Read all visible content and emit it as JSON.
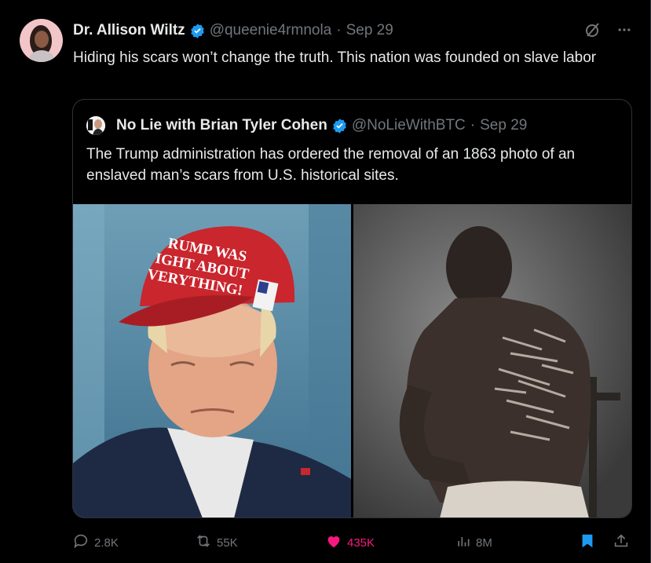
{
  "post": {
    "author_name": "Dr. Allison Wiltz",
    "handle": "@queenie4rmnola",
    "separator": "·",
    "date": "Sep 29",
    "text": "Hiding his scars won’t change the truth. This nation was founded on slave labor",
    "more_icon": "more-horizontal-icon",
    "grok_icon": "grok-slash-icon"
  },
  "quote": {
    "author_name": "No Lie with Brian Tyler Cohen",
    "handle": "@NoLieWithBTC",
    "separator": "·",
    "date": "Sep 29",
    "text": "The Trump administration has ordered the removal of an 1863 photo of an enslaved man’s scars from U.S. historical sites.",
    "hat_text_line1": "RUMP WAS",
    "hat_text_line2": "IGHT ABOUT",
    "hat_text_line3": "VERYTHING!"
  },
  "actions": {
    "replies": "2.8K",
    "reposts": "55K",
    "likes": "435K",
    "views": "8M"
  },
  "colors": {
    "background": "#000000",
    "text": "#e7e9ea",
    "muted": "#71767b",
    "verified": "#1d9bf0",
    "like": "#f91880",
    "border": "#2f3336"
  }
}
